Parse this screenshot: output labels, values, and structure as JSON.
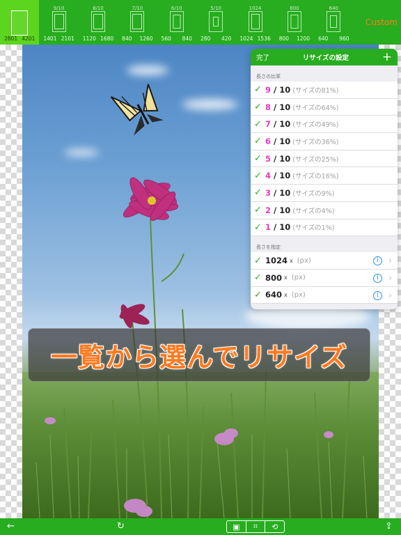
{
  "top_sizes": [
    {
      "ratio": "",
      "w": "2801",
      "h": "4201",
      "selected": true
    },
    {
      "ratio": "9/10",
      "w": "1401",
      "h": "2101",
      "selected": false
    },
    {
      "ratio": "8/10",
      "w": "1120",
      "h": "1680",
      "selected": false
    },
    {
      "ratio": "7/10",
      "w": "840",
      "h": "1260",
      "selected": false
    },
    {
      "ratio": "6/10",
      "w": "560",
      "h": "840",
      "selected": false
    },
    {
      "ratio": "5/10",
      "w": "280",
      "h": "420",
      "selected": false
    },
    {
      "ratio": "1024",
      "w": "1024",
      "h": "1536",
      "selected": false
    },
    {
      "ratio": "800",
      "w": "800",
      "h": "1200",
      "selected": false
    },
    {
      "ratio": "640",
      "w": "640",
      "h": "960",
      "selected": false
    }
  ],
  "custom_label": "Custom",
  "panel": {
    "done": "完了",
    "title": "リサイズの設定",
    "add": "+",
    "section_ratio": "長さの比率",
    "ratios": [
      {
        "num": "9",
        "den": "/ 10",
        "pct": "(サイズの81%)"
      },
      {
        "num": "8",
        "den": "/ 10",
        "pct": "(サイズの64%)"
      },
      {
        "num": "7",
        "den": "/ 10",
        "pct": "(サイズの49%)"
      },
      {
        "num": "6",
        "den": "/ 10",
        "pct": "(サイズの36%)"
      },
      {
        "num": "5",
        "den": "/ 10",
        "pct": "(サイズの25%)"
      },
      {
        "num": "4",
        "den": "/ 10",
        "pct": "(サイズの16%)"
      },
      {
        "num": "3",
        "den": "/ 10",
        "pct": "(サイズの9%)"
      },
      {
        "num": "2",
        "den": "/ 10",
        "pct": "(サイズの4%)"
      },
      {
        "num": "1",
        "den": "/ 10",
        "pct": "(サイズの1%)"
      }
    ],
    "section_length": "長さを指定",
    "lengths": [
      {
        "value": "1024",
        "x": "x",
        "unit": "(px)"
      },
      {
        "value": "800",
        "x": "x",
        "unit": "(px)"
      },
      {
        "value": "640",
        "x": "x",
        "unit": "(px)"
      }
    ]
  },
  "banner": "一覧から選んでリサイズ",
  "colors": {
    "accent": "#27ad1f",
    "magenta": "#e13cc0",
    "orange": "#ff7a1f"
  },
  "bottom": {
    "back_icon": "←",
    "rotate_icon": "↻",
    "seg_icons": [
      "▣",
      "⌗",
      "⟲"
    ],
    "share_icon": "⇪"
  }
}
